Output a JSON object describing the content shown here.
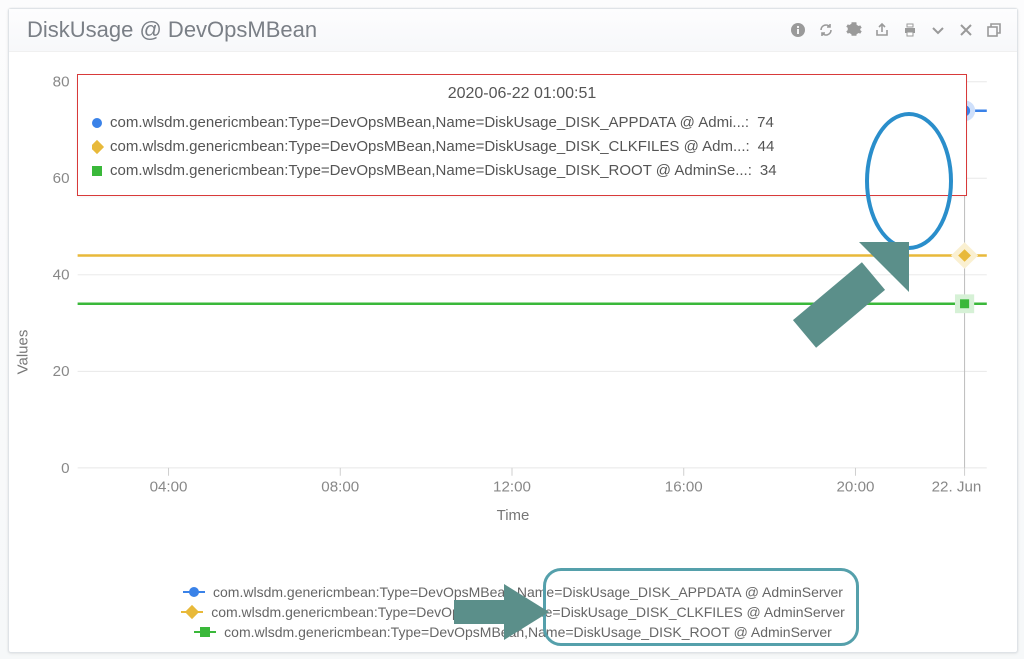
{
  "header": {
    "title": "DiskUsage @ DevOpsMBean"
  },
  "tooltip": {
    "title": "2020-06-22 01:00:51",
    "rows": [
      {
        "color": "blue",
        "shape": "circle",
        "label": "com.wlsdm.genericmbean:Type=DevOpsMBean,Name=DiskUsage_DISK_APPDATA @ Admi...:",
        "value": "74"
      },
      {
        "color": "yellow",
        "shape": "diamond",
        "label": "com.wlsdm.genericmbean:Type=DevOpsMBean,Name=DiskUsage_DISK_CLKFILES @ Adm...:",
        "value": "44"
      },
      {
        "color": "green",
        "shape": "square",
        "label": "com.wlsdm.genericmbean:Type=DevOpsMBean,Name=DiskUsage_DISK_ROOT @ AdminSe...:",
        "value": "34"
      }
    ]
  },
  "axes": {
    "xlabel": "Time",
    "ylabel": "Values",
    "x_ticks": [
      "04:00",
      "08:00",
      "12:00",
      "16:00",
      "20:00",
      "22. Jun"
    ],
    "y_ticks": [
      "0",
      "20",
      "40",
      "60",
      "80"
    ]
  },
  "legend": {
    "items": [
      {
        "color": "blue",
        "label": "com.wlsdm.genericmbean:Type=DevOpsMBean,Name=DiskUsage_DISK_APPDATA @ AdminServer"
      },
      {
        "color": "yellow",
        "label": "com.wlsdm.genericmbean:Type=DevOpsMBean,Name=DiskUsage_DISK_CLKFILES @ AdminServer"
      },
      {
        "color": "green",
        "label": "com.wlsdm.genericmbean:Type=DevOpsMBean,Name=DiskUsage_DISK_ROOT @ AdminServer"
      }
    ]
  },
  "chart_data": {
    "type": "line",
    "title": "DiskUsage @ DevOpsMBean",
    "xlabel": "Time",
    "ylabel": "Values",
    "ylim": [
      0,
      80
    ],
    "x": [
      "2020-06-21 04:00",
      "2020-06-21 08:00",
      "2020-06-21 12:00",
      "2020-06-21 16:00",
      "2020-06-21 20:00",
      "2020-06-22 01:00:51"
    ],
    "x_tick_labels": [
      "04:00",
      "08:00",
      "12:00",
      "16:00",
      "20:00",
      "22. Jun"
    ],
    "series": [
      {
        "name": "com.wlsdm.genericmbean:Type=DevOpsMBean,Name=DiskUsage_DISK_APPDATA @ AdminServer",
        "color": "#3a82e8",
        "values": [
          74,
          74,
          74,
          74,
          74,
          74
        ]
      },
      {
        "name": "com.wlsdm.genericmbean:Type=DevOpsMBean,Name=DiskUsage_DISK_CLKFILES @ AdminServer",
        "color": "#e8b93a",
        "values": [
          44,
          44,
          44,
          44,
          44,
          44
        ]
      },
      {
        "name": "com.wlsdm.genericmbean:Type=DevOpsMBean,Name=DiskUsage_DISK_ROOT @ AdminServer",
        "color": "#3ab83a",
        "values": [
          34,
          34,
          34,
          34,
          34,
          34
        ]
      }
    ],
    "hover_point_index": 5
  }
}
